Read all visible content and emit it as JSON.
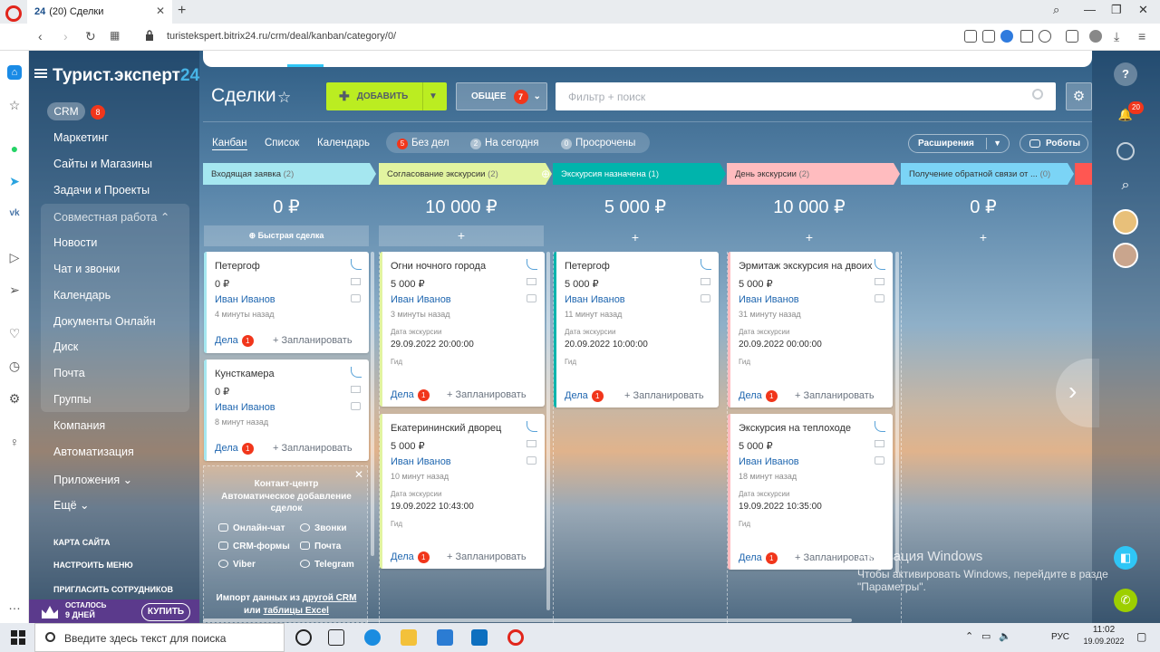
{
  "browser": {
    "tab_favicon": "24",
    "tab_title": "(20) Сделки",
    "url": "turistekspert.bitrix24.ru/crm/deal/kanban/category/0/"
  },
  "sidebar": {
    "brand": "Турист.эксперт",
    "brand_suffix": "24",
    "crm_label": "CRM",
    "crm_badge": "8",
    "items": [
      "Маркетинг",
      "Сайты и Магазины",
      "Задачи и Проекты",
      "Совместная работа ⌃",
      "Новости",
      "Чат и звонки",
      "Календарь",
      "Документы Онлайн",
      "Диск",
      "Почта",
      "Группы",
      "Компания",
      "Автоматизация",
      "Приложения ⌄",
      "Ещё ⌄"
    ],
    "small_items": [
      "КАРТА САЙТА",
      "НАСТРОИТЬ МЕНЮ",
      "ПРИГЛАСИТЬ СОТРУДНИКОВ"
    ],
    "promo_line1": "ОСТАЛОСЬ",
    "promo_line2": "9 ДНЕЙ",
    "buy": "КУПИТЬ"
  },
  "header": {
    "title": "Сделки",
    "add": "ДОБАВИТЬ",
    "general": "ОБЩЕЕ",
    "general_badge": "7",
    "search_placeholder": "Фильтр + поиск"
  },
  "views": [
    "Канбан",
    "Список",
    "Календарь"
  ],
  "counters": [
    {
      "count": "5",
      "label": "Без дел"
    },
    {
      "count": "2",
      "label": "На сегодня"
    },
    {
      "count": "0",
      "label": "Просрочены"
    }
  ],
  "extensions": "Расширения",
  "robots": "Роботы",
  "columns": [
    {
      "name": "Входящая заявка",
      "count": "(2)",
      "sum": "0 ₽",
      "color": "#a5e7f0"
    },
    {
      "name": "Согласование экскурсии",
      "count": "(2)",
      "sum": "10 000 ₽",
      "color": "#e2f4a0"
    },
    {
      "name": "Экскурсия назначена",
      "count": "(1)",
      "sum": "5 000 ₽",
      "color": "#00b4ac"
    },
    {
      "name": "День экскурсии",
      "count": "(2)",
      "sum": "10 000 ₽",
      "color": "#ffbcbf"
    },
    {
      "name": "Получение обратной связи от ...",
      "count": "(0)",
      "sum": "0 ₽",
      "color": "#7bd4f6"
    }
  ],
  "quick_deal": "Быстрая сделка",
  "cards": {
    "c1": {
      "title": "Петергоф",
      "sum": "0 ₽",
      "user": "Иван Иванов",
      "ago": "4 минуты назад"
    },
    "c2": {
      "title": "Кунсткамера",
      "sum": "0 ₽",
      "user": "Иван Иванов",
      "ago": "8 минут назад"
    },
    "c3": {
      "title": "Огни ночного города",
      "sum": "5 000 ₽",
      "user": "Иван Иванов",
      "ago": "3 минуты назад",
      "date": "29.09.2022 20:00:00"
    },
    "c4": {
      "title": "Екатерининский дворец",
      "sum": "5 000 ₽",
      "user": "Иван Иванов",
      "ago": "10 минут назад",
      "date": "19.09.2022 10:43:00"
    },
    "c5": {
      "title": "Петергоф",
      "sum": "5 000 ₽",
      "user": "Иван Иванов",
      "ago": "11 минут назад",
      "date": "20.09.2022 10:00:00"
    },
    "c6": {
      "title": "Эрмитаж экскурсия на двоих",
      "sum": "5 000 ₽",
      "user": "Иван Иванов",
      "ago": "31 минуту назад",
      "date": "20.09.2022 00:00:00"
    },
    "c7": {
      "title": "Экскурсия на теплоходе",
      "sum": "5 000 ₽",
      "user": "Иван Иванов",
      "ago": "18 минут назад",
      "date": "19.09.2022 10:35:00"
    }
  },
  "card_labels": {
    "date": "Дата экскурсии",
    "guide": "Гид",
    "deals": "Дела",
    "deals_badge": "1",
    "plan": "+ Запланировать"
  },
  "contact": {
    "title": "Контакт-центр",
    "subtitle1": "Автоматическое добавление",
    "subtitle2": "сделок",
    "items": [
      "Онлайн-чат",
      "Звонки",
      "CRM-формы",
      "Почта",
      "Viber",
      "Telegram"
    ],
    "import1": "Импорт данных из ",
    "import_link1": "другой CRM",
    "import2": "или ",
    "import_link2": "таблицы Excel"
  },
  "right_panel": {
    "notif_badge": "20"
  },
  "watermark": {
    "line1": "Активация Windows",
    "line2": "Чтобы активировать Windows, перейдите в разде",
    "line3": "\"Параметры\"."
  },
  "taskbar": {
    "search": "Введите здесь текст для поиска",
    "lang": "РУС",
    "time": "11:02",
    "date": "19.09.2022"
  }
}
